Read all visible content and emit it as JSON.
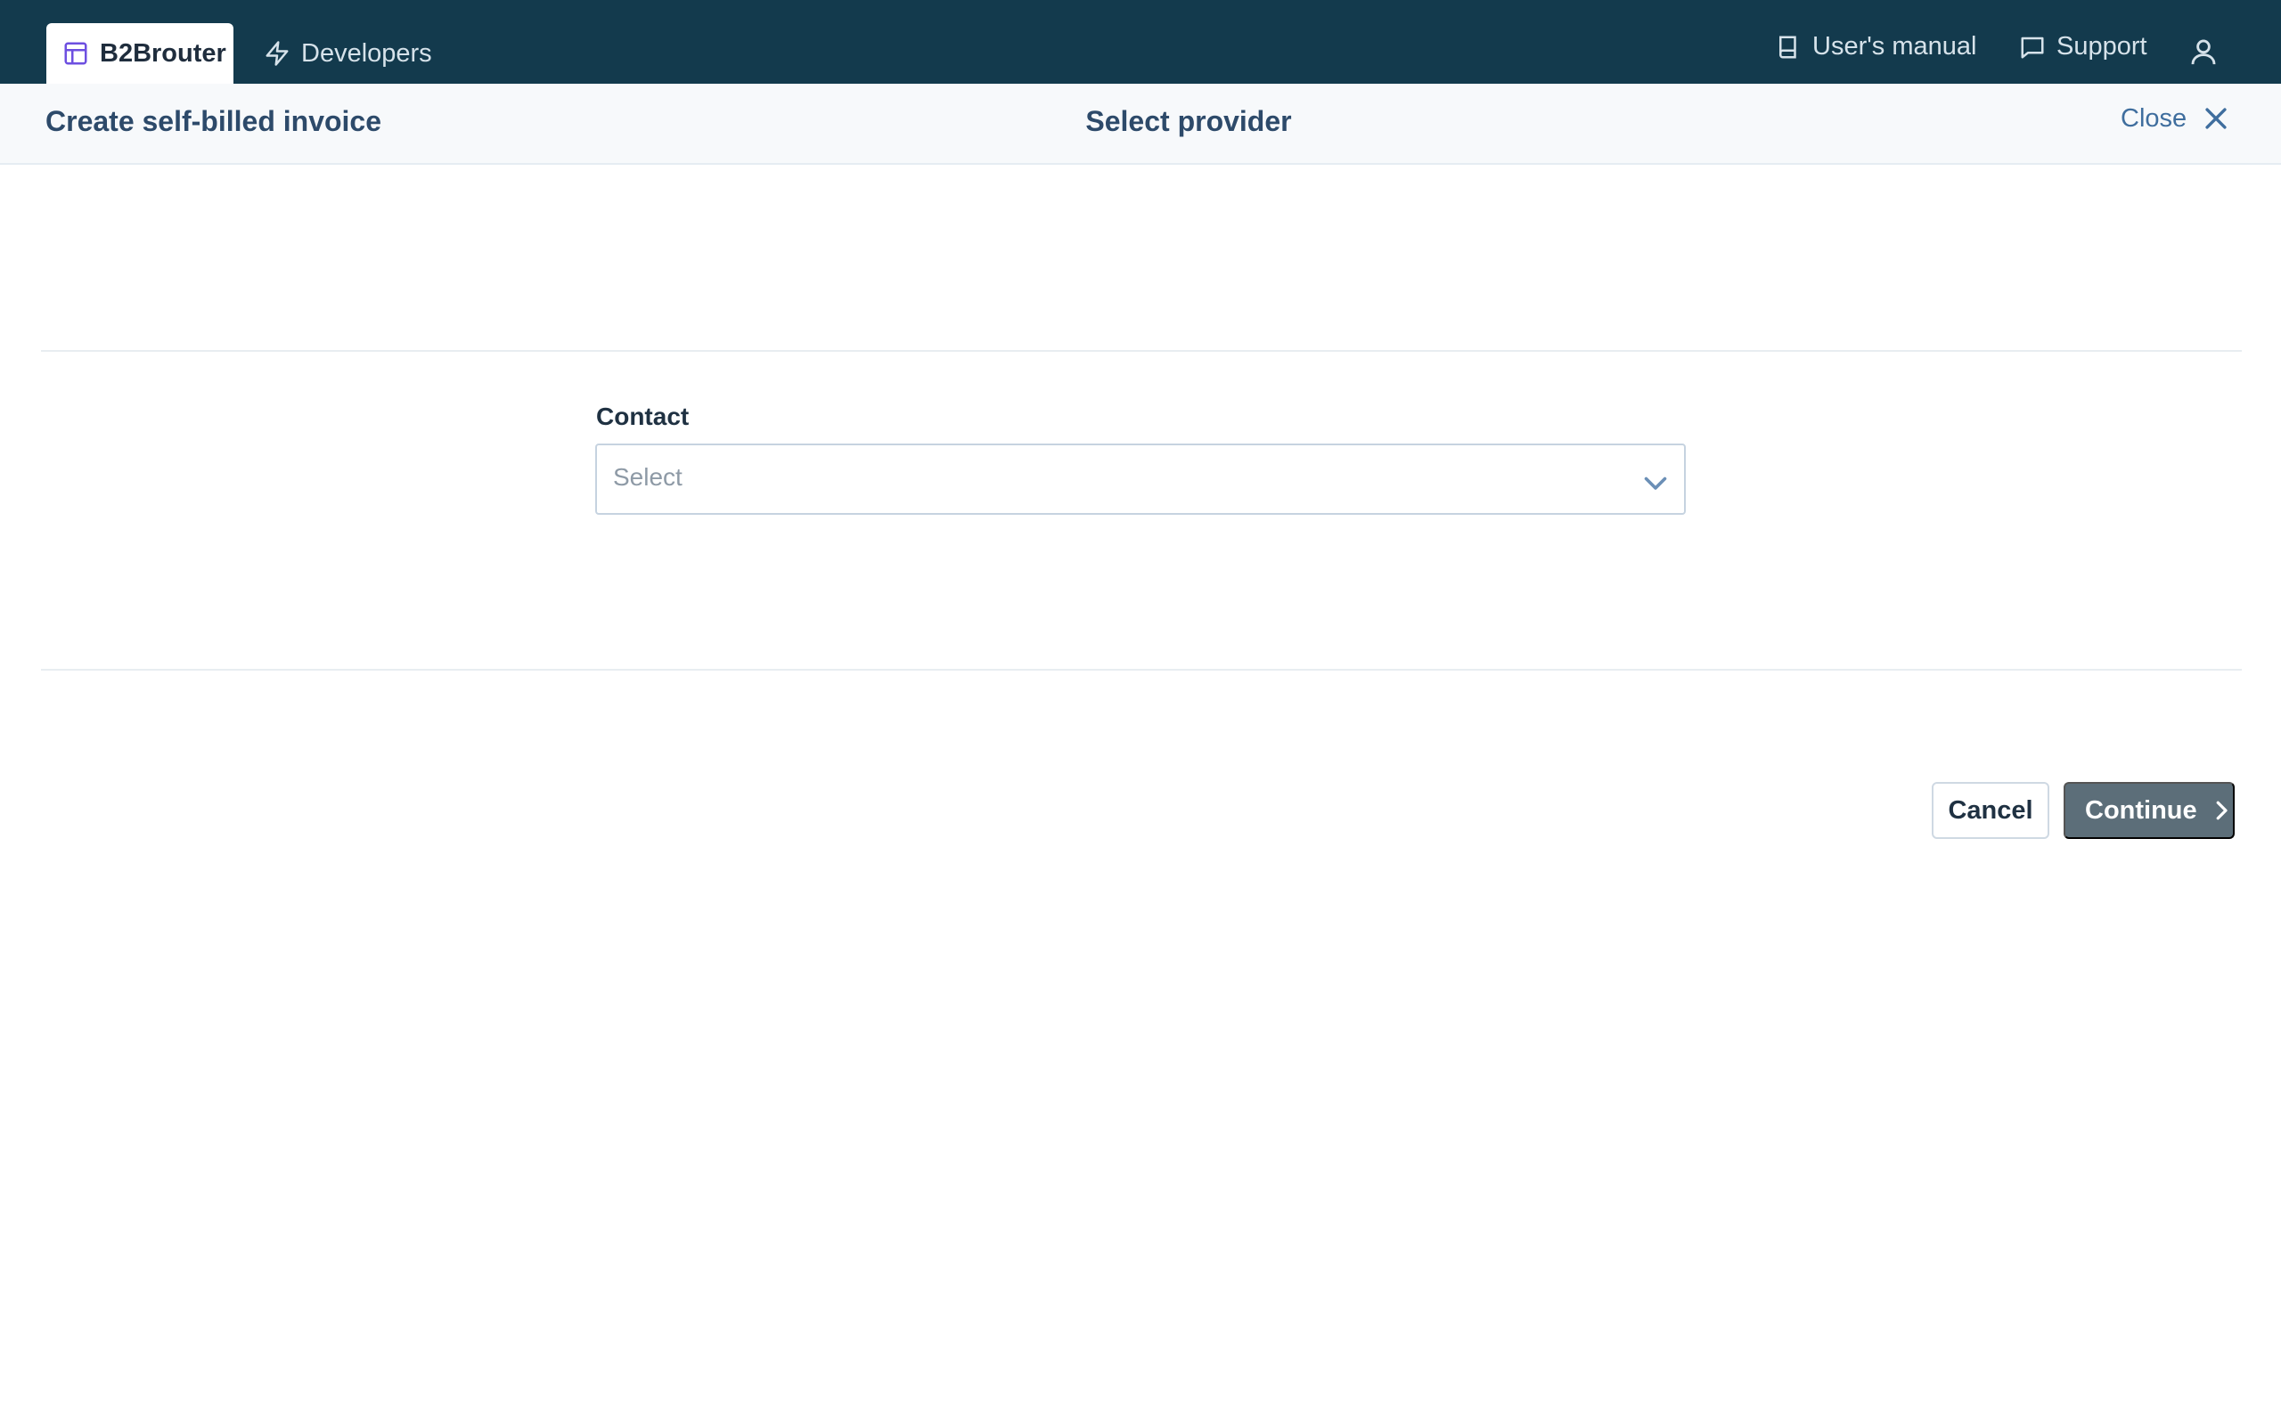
{
  "topbar": {
    "tabs": [
      {
        "label": "B2Brouter",
        "icon": "layout-icon",
        "active": true
      },
      {
        "label": "Developers",
        "icon": "bolt-icon",
        "active": false
      }
    ],
    "links": [
      {
        "label": "User's manual",
        "icon": "book-icon"
      },
      {
        "label": "Support",
        "icon": "chat-icon"
      }
    ],
    "user_icon": "user-icon",
    "background_color": "#133a4d",
    "active_tab_icon_color": "#6d4fe0"
  },
  "subheader": {
    "title": "Create self-billed invoice",
    "step": "Select provider",
    "close_label": "Close"
  },
  "form": {
    "contact_label": "Contact",
    "contact_value": "Select"
  },
  "actions": {
    "cancel_label": "Cancel",
    "continue_label": "Continue",
    "continue_color": "#5c6e79"
  }
}
